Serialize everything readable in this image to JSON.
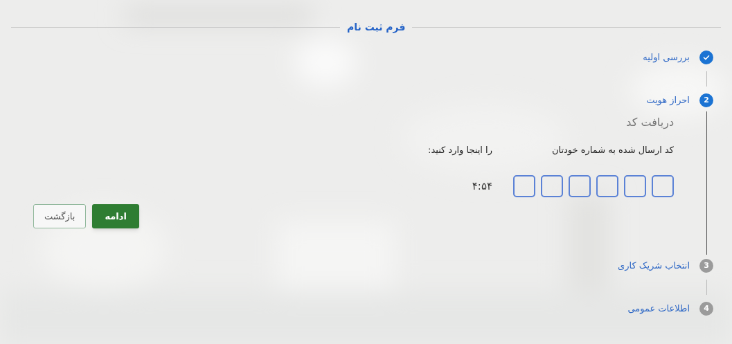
{
  "form": {
    "title": "فرم ثبت نام"
  },
  "steps": [
    {
      "kind": "done",
      "label": "بررسی اولیه"
    },
    {
      "kind": "current",
      "label": "احراز هویت",
      "number": "2"
    },
    {
      "kind": "upcoming",
      "label": "انتخاب شریک کاری",
      "number": "3"
    },
    {
      "kind": "upcoming",
      "label": "اطلاعات عمومی",
      "number": "4"
    }
  ],
  "verification": {
    "heading": "دریافت کد",
    "instruction_start": "کد ارسال شده به شماره خودتان",
    "instruction_end": "را اینجا وارد کنید:",
    "code_fields": [
      {
        "filled": false
      },
      {
        "filled": false
      },
      {
        "filled": false
      },
      {
        "filled": false
      },
      {
        "filled": false
      },
      {
        "filled": false
      }
    ],
    "timer": "۴:۵۴"
  },
  "buttons": [
    {
      "label": "ادامه",
      "kind": "primary"
    },
    {
      "label": "بازگشت",
      "kind": "secondary"
    }
  ]
}
